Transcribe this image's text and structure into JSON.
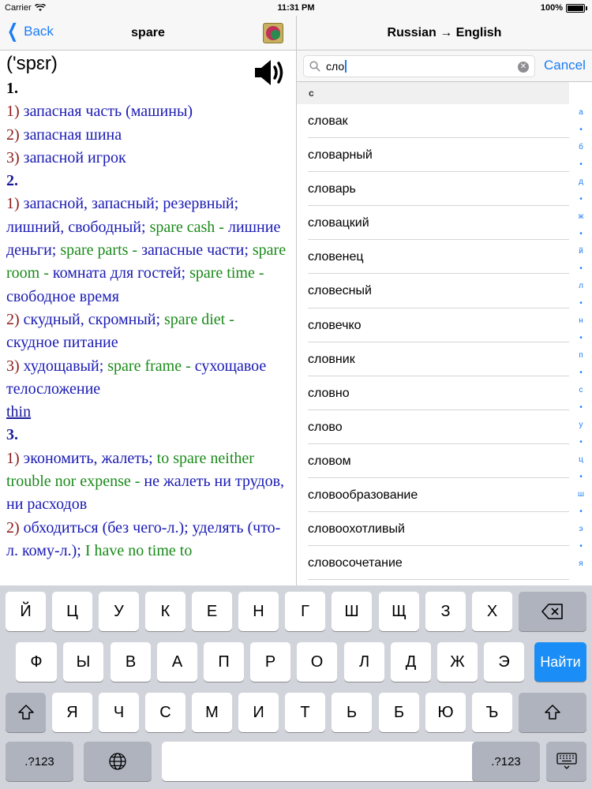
{
  "status_bar": {
    "carrier": "Carrier",
    "time": "11:31 PM",
    "battery": "100%"
  },
  "left_nav": {
    "back_label": "Back",
    "title": "spare",
    "flag_icon": "dictionary-icon"
  },
  "entry": {
    "transcription": "('spɛr)",
    "numbers": [
      "1.",
      "2.",
      "3."
    ],
    "s1": [
      {
        "n": "1)",
        "ru": "запасная часть (машины)"
      },
      {
        "n": "2)",
        "ru": "запасная шина"
      },
      {
        "n": "3)",
        "ru": "запасной игрок"
      }
    ],
    "s2_1": {
      "n": "1)",
      "ru": "запасной, запасный; резервный; лишний, свободный;",
      "ex1": "spare cash -",
      "tr1": "лишние деньги;",
      "ex2": "spare parts -",
      "tr2": "запасные части;",
      "ex3": "spare room -",
      "tr3": "комната для гостей;",
      "ex4": "spare time -",
      "tr4": "свободное время"
    },
    "s2_2": {
      "n": "2)",
      "ru": "скудный, скромный;",
      "ex": "spare diet -",
      "tr": "скудное питание"
    },
    "s2_3": {
      "n": "3)",
      "ru": "худощавый;",
      "ex": "spare frame -",
      "tr": "сухощавое телосложение",
      "link": "thin"
    },
    "s3_1": {
      "n": "1)",
      "ru": "экономить, жалеть;",
      "ex": "to spare neither trouble nor expense -",
      "tr": "не жалеть ни трудов, ни расходов"
    },
    "s3_2": {
      "n": "2)",
      "ru": "обходиться (без чего-л.); уделять (что-л. кому-л.);",
      "ex": "I have no time to"
    }
  },
  "right_nav": {
    "title": "Russian → English"
  },
  "search": {
    "value": "сло",
    "cancel": "Cancel"
  },
  "list": {
    "section": "с",
    "items": [
      "словак",
      "словарный",
      "словарь",
      "словацкий",
      "словенец",
      "словесный",
      "словечко",
      "словник",
      "словно",
      "слово",
      "словом",
      "словообразование",
      "словоохотливый",
      "словосочетание"
    ]
  },
  "index": [
    "а",
    "•",
    "б",
    "•",
    "д",
    "•",
    "ж",
    "•",
    "й",
    "•",
    "л",
    "•",
    "н",
    "•",
    "п",
    "•",
    "с",
    "•",
    "у",
    "•",
    "ц",
    "•",
    "ш",
    "•",
    "э",
    "•",
    "я"
  ],
  "keyboard": {
    "row1": [
      "Й",
      "Ц",
      "У",
      "К",
      "Е",
      "Н",
      "Г",
      "Ш",
      "Щ",
      "З",
      "Х"
    ],
    "row2": [
      "Ф",
      "Ы",
      "В",
      "А",
      "П",
      "Р",
      "О",
      "Л",
      "Д",
      "Ж",
      "Э"
    ],
    "row3": [
      "Я",
      "Ч",
      "С",
      "М",
      "И",
      "Т",
      "Ь",
      "Б",
      "Ю",
      "Ъ"
    ],
    "go": "Найти",
    "numbers": ".?123"
  }
}
